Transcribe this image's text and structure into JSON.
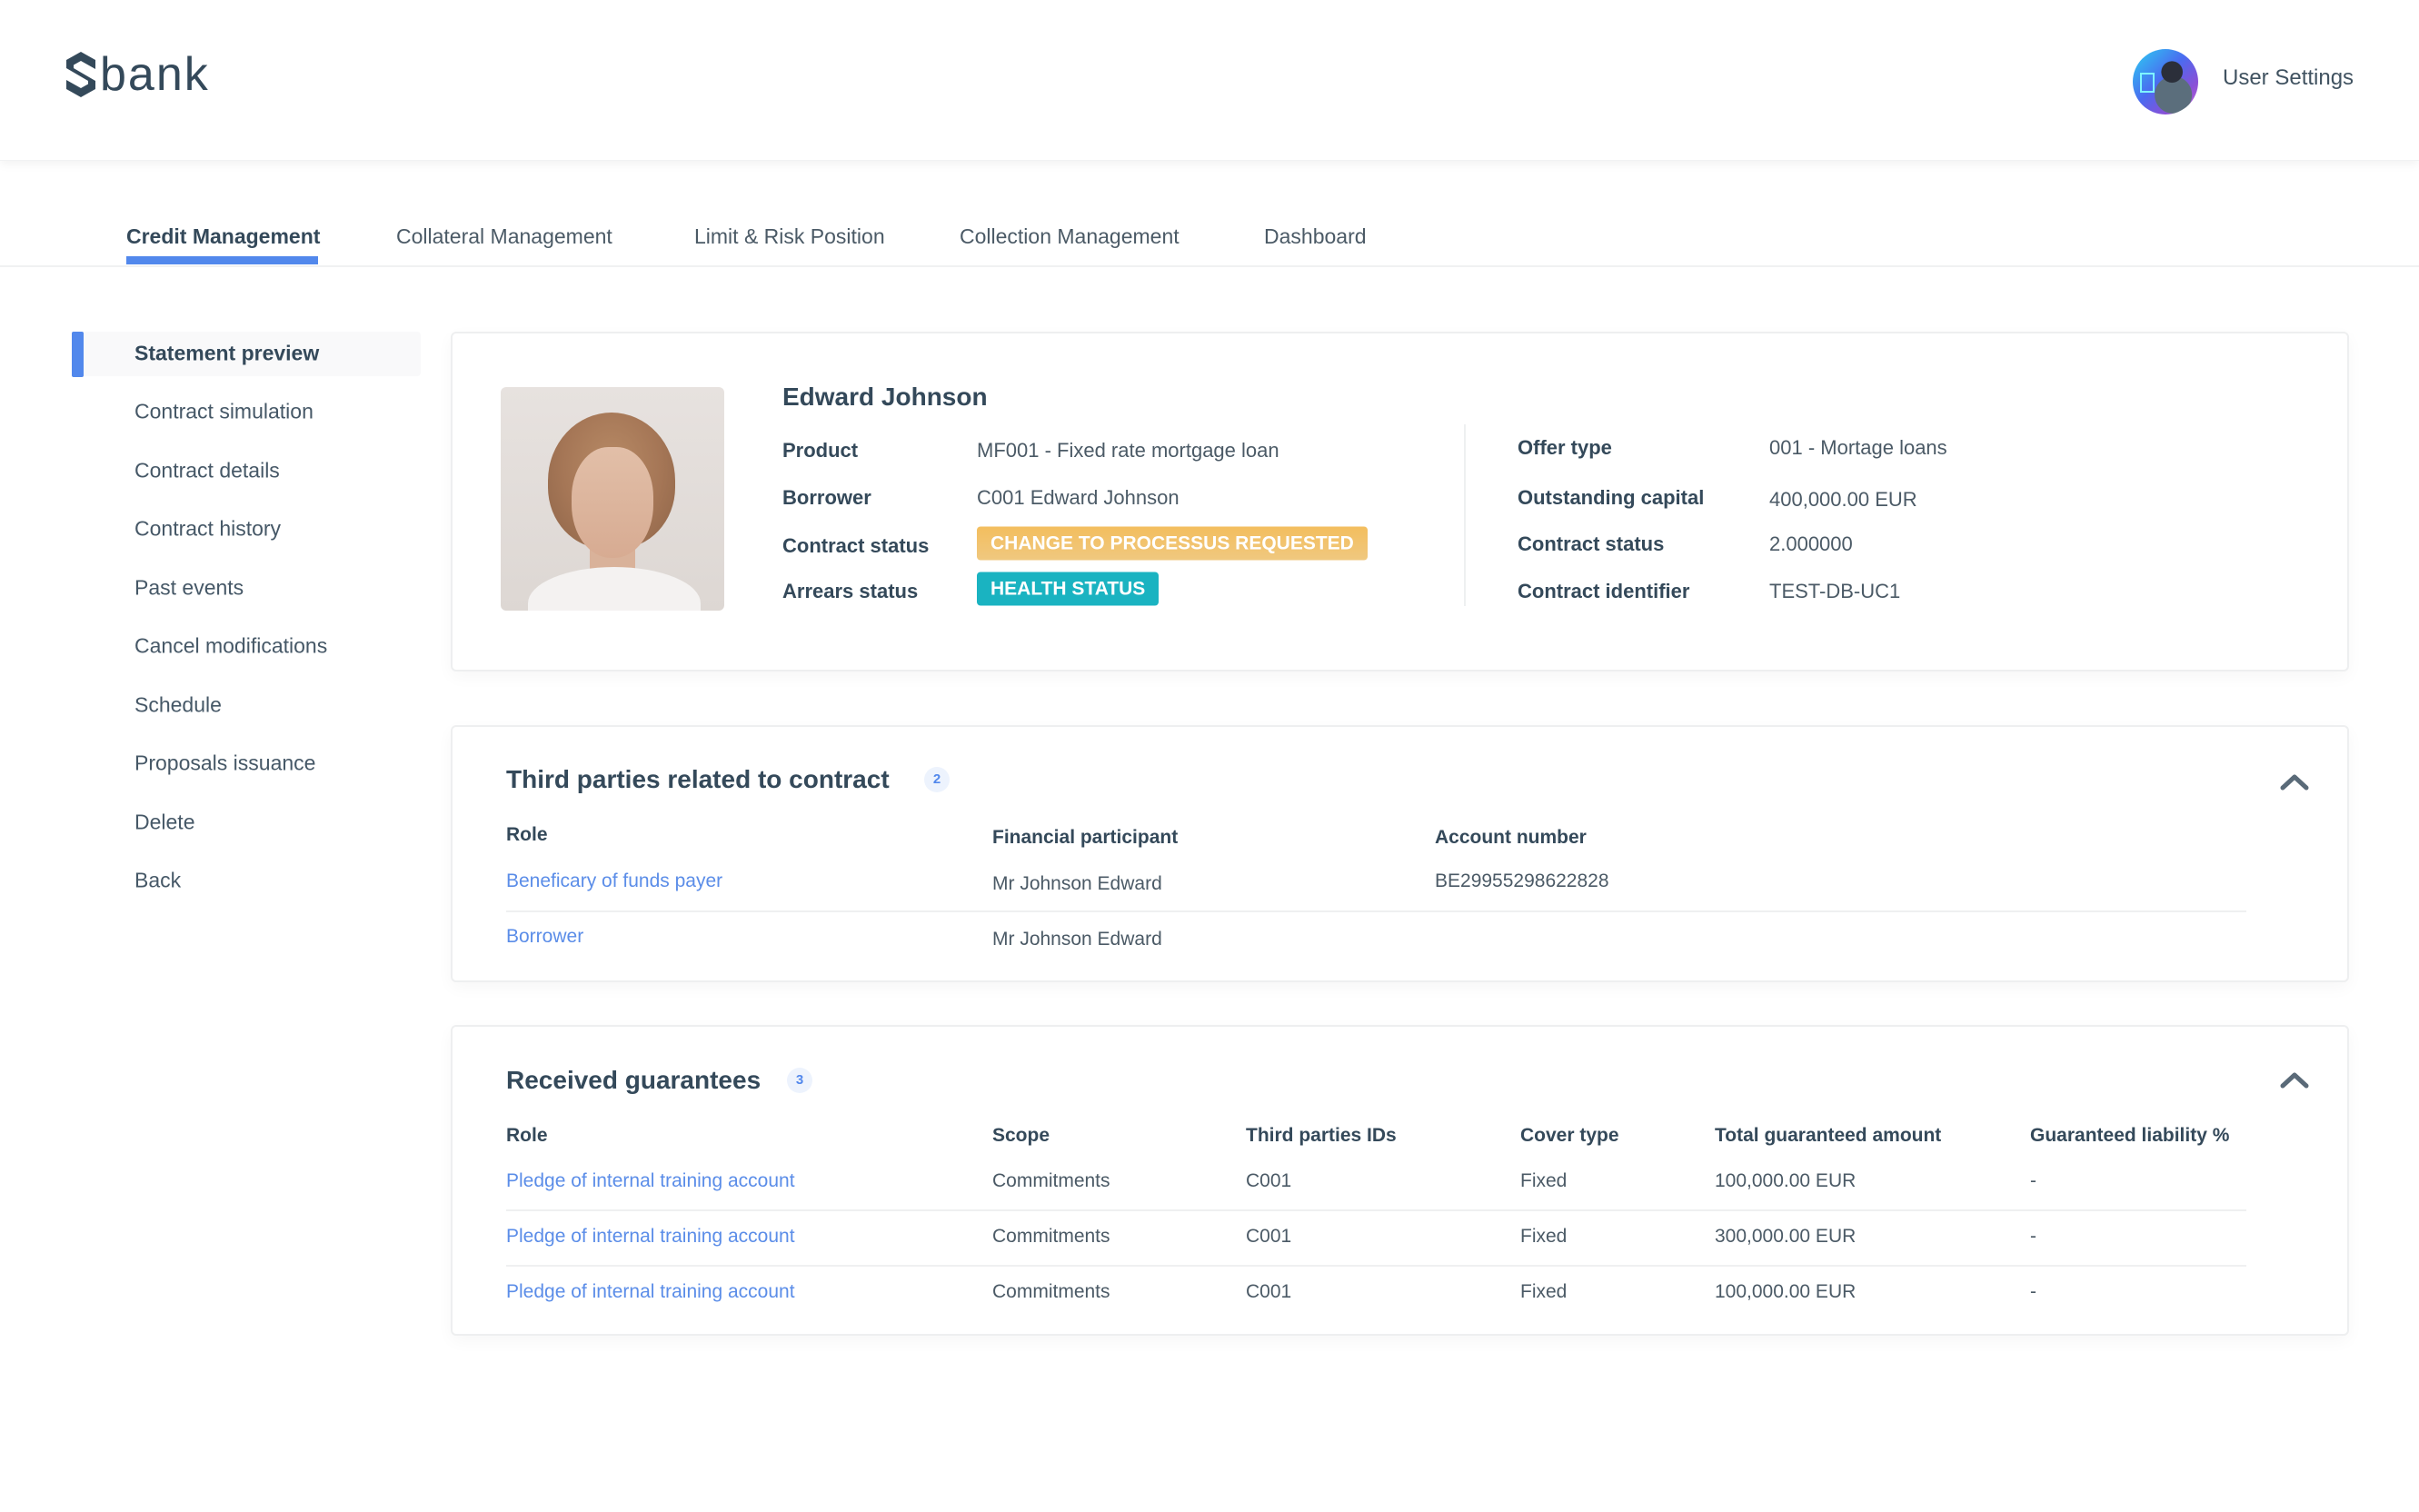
{
  "header": {
    "brand": "bank",
    "logo_mark": "S",
    "user_settings_label": "User Settings",
    "avatar_icon": "user-avatar"
  },
  "tabs": [
    {
      "label": "Credit Management",
      "active": true
    },
    {
      "label": "Collateral Management",
      "active": false
    },
    {
      "label": "Limit & Risk Position",
      "active": false
    },
    {
      "label": "Collection Management",
      "active": false
    },
    {
      "label": "Dashboard",
      "active": false
    }
  ],
  "sidebar": {
    "items": [
      {
        "label": "Statement preview",
        "active": true
      },
      {
        "label": "Contract simulation"
      },
      {
        "label": "Contract details"
      },
      {
        "label": "Contract history"
      },
      {
        "label": "Past events"
      },
      {
        "label": "Cancel modifications"
      },
      {
        "label": "Schedule"
      },
      {
        "label": "Proposals issuance"
      },
      {
        "label": "Delete"
      },
      {
        "label": "Back"
      }
    ]
  },
  "contract": {
    "name": "Edward Johnson",
    "left_fields": [
      {
        "label": "Product",
        "value": "MF001 - Fixed rate mortgage loan"
      },
      {
        "label": "Borrower",
        "value": "C001 Edward Johnson"
      },
      {
        "label": "Contract status",
        "badge": "CHANGE TO PROCESSUS REQUESTED",
        "badge_color": "#f2c26b"
      },
      {
        "label": "Arrears status",
        "badge": "HEALTH STATUS",
        "badge_color": "#1ab3c1"
      }
    ],
    "right_fields": [
      {
        "label": "Offer type",
        "value": "001 - Mortage loans"
      },
      {
        "label": "Outstanding capital",
        "value": "400,000.00 EUR"
      },
      {
        "label": "Contract status",
        "value": "2.000000"
      },
      {
        "label": "Contract identifier",
        "value": "TEST-DB-UC1"
      }
    ]
  },
  "third_parties": {
    "title": "Third parties related to contract",
    "count": "2",
    "columns": [
      "Role",
      "Financial participant",
      "Account number"
    ],
    "rows": [
      {
        "role": "Beneficary of funds payer",
        "participant": "Mr Johnson Edward",
        "account": "BE29955298622828"
      },
      {
        "role": "Borrower",
        "participant": "Mr Johnson Edward",
        "account": ""
      }
    ]
  },
  "guarantees": {
    "title": "Received guarantees",
    "count": "3",
    "columns": [
      "Role",
      "Scope",
      "Third parties IDs",
      "Cover type",
      "Total guaranteed amount",
      "Guaranteed liability %"
    ],
    "rows": [
      {
        "role": "Pledge of internal training account",
        "scope": "Commitments",
        "ids": "C001",
        "cover": "Fixed",
        "amount": "100,000.00 EUR",
        "liability": "-"
      },
      {
        "role": "Pledge of internal training account",
        "scope": "Commitments",
        "ids": "C001",
        "cover": "Fixed",
        "amount": "300,000.00 EUR",
        "liability": "-"
      },
      {
        "role": "Pledge of internal training account",
        "scope": "Commitments",
        "ids": "C001",
        "cover": "Fixed",
        "amount": "100,000.00 EUR",
        "liability": "-"
      }
    ]
  },
  "colors": {
    "accent": "#5288ec",
    "text": "#34495a",
    "link": "#5b8de8",
    "badge_orange": "#f2c26b",
    "badge_teal": "#1ab3c1"
  }
}
